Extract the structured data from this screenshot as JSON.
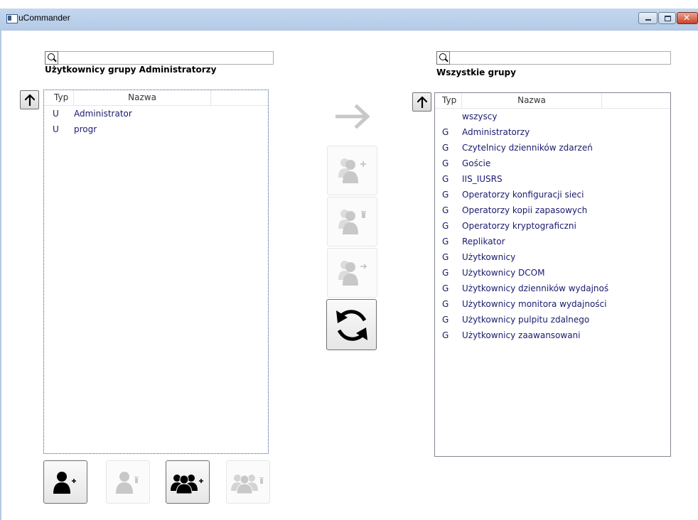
{
  "window": {
    "title": "uCommander"
  },
  "left_panel": {
    "search": {
      "value": "",
      "placeholder": ""
    },
    "title": "Użytkownicy grupy Administratorzy",
    "columns": {
      "typ": "Typ",
      "name": "Nazwa"
    },
    "rows": [
      {
        "typ": "U",
        "name": "Administrator"
      },
      {
        "typ": "U",
        "name": "progr"
      }
    ]
  },
  "right_panel": {
    "search": {
      "value": "",
      "placeholder": ""
    },
    "title": "Wszystkie grupy",
    "columns": {
      "typ": "Typ",
      "name": "Nazwa"
    },
    "rows": [
      {
        "typ": "",
        "name": "wszyscy"
      },
      {
        "typ": "G",
        "name": "Administratorzy"
      },
      {
        "typ": "G",
        "name": "Czytelnicy dzienników zdarzeń"
      },
      {
        "typ": "G",
        "name": "Goście"
      },
      {
        "typ": "G",
        "name": "IIS_IUSRS"
      },
      {
        "typ": "G",
        "name": "Operatorzy konfiguracji sieci"
      },
      {
        "typ": "G",
        "name": "Operatorzy kopii zapasowych"
      },
      {
        "typ": "G",
        "name": "Operatorzy kryptograficzni"
      },
      {
        "typ": "G",
        "name": "Replikator"
      },
      {
        "typ": "G",
        "name": "Użytkownicy"
      },
      {
        "typ": "G",
        "name": "Użytkownicy DCOM"
      },
      {
        "typ": "G",
        "name": "Użytkownicy dzienników wydajności"
      },
      {
        "typ": "G",
        "name": "Użytkownicy monitora wydajności"
      },
      {
        "typ": "G",
        "name": "Użytkownicy pulpitu zdalnego"
      },
      {
        "typ": "G",
        "name": "Użytkownicy zaawansowani"
      }
    ]
  },
  "middle_actions": {
    "direction_arrow": {
      "icon": "arrow-right-icon",
      "enabled": false
    },
    "add_user_to_group": {
      "icon": "user-add-icon",
      "enabled": false
    },
    "remove_user_from_group": {
      "icon": "user-delete-icon",
      "enabled": false
    },
    "move_user": {
      "icon": "user-move-icon",
      "enabled": false
    },
    "refresh": {
      "icon": "refresh-icon",
      "enabled": true
    }
  },
  "bottom_actions": [
    {
      "icon": "user-add-icon",
      "enabled": true
    },
    {
      "icon": "user-delete-icon",
      "enabled": false
    },
    {
      "icon": "group-add-icon",
      "enabled": true
    },
    {
      "icon": "group-delete-icon",
      "enabled": false
    }
  ],
  "colors": {
    "titlebar": "#c3d7ef",
    "list_text": "#1a1a6e",
    "disabled_icon": "#c8c8c8",
    "enabled_icon": "#000000"
  }
}
